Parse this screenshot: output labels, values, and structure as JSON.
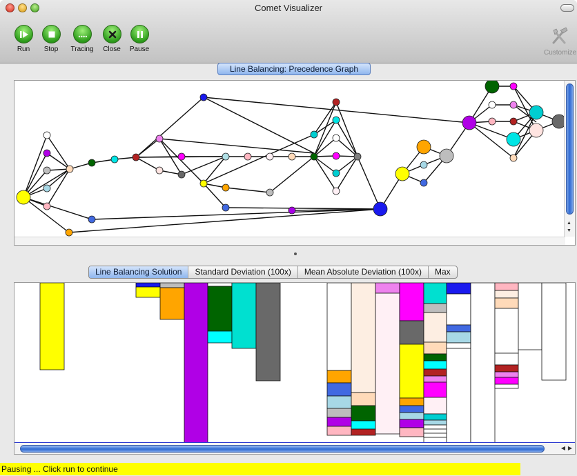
{
  "window": {
    "title": "Comet Visualizer"
  },
  "toolbar": {
    "items": [
      {
        "label": "Run",
        "icon": "play-step-icon"
      },
      {
        "label": "Stop",
        "icon": "stop-icon"
      },
      {
        "label": "Tracing",
        "icon": "ellipsis-icon"
      },
      {
        "label": "Close",
        "icon": "x-icon"
      },
      {
        "label": "Pause",
        "icon": "pause-icon"
      }
    ],
    "customize_label": "Customize"
  },
  "top_panel": {
    "tab_label": "Line Balancing: Precedence Graph"
  },
  "bottom_panel": {
    "tabs": [
      {
        "label": "Line Balancing Solution",
        "active": true
      },
      {
        "label": "Standard Deviation (100x)",
        "active": false
      },
      {
        "label": "Mean Absolute Deviation (100x)",
        "active": false
      },
      {
        "label": "Max",
        "active": false
      }
    ]
  },
  "status": {
    "text": "Pausing ... Click run to continue",
    "color": "#ffff00"
  },
  "colors": {
    "accent_blue": "#2f6bd4",
    "toolbar_green": "#2e9d1c",
    "node_yellow": "#ffff00",
    "node_purple": "#a800e6",
    "node_blue": "#1a1aee"
  },
  "graph": {
    "node_colors": [
      "yellow",
      "magenta",
      "gray",
      "lightblue",
      "pink",
      "peachpuff",
      "darkgreen",
      "cyan",
      "darkred",
      "orange",
      "royalblue",
      "blue",
      "purple",
      "turquoise",
      "mistyrose",
      "lightcyan"
    ]
  }
}
